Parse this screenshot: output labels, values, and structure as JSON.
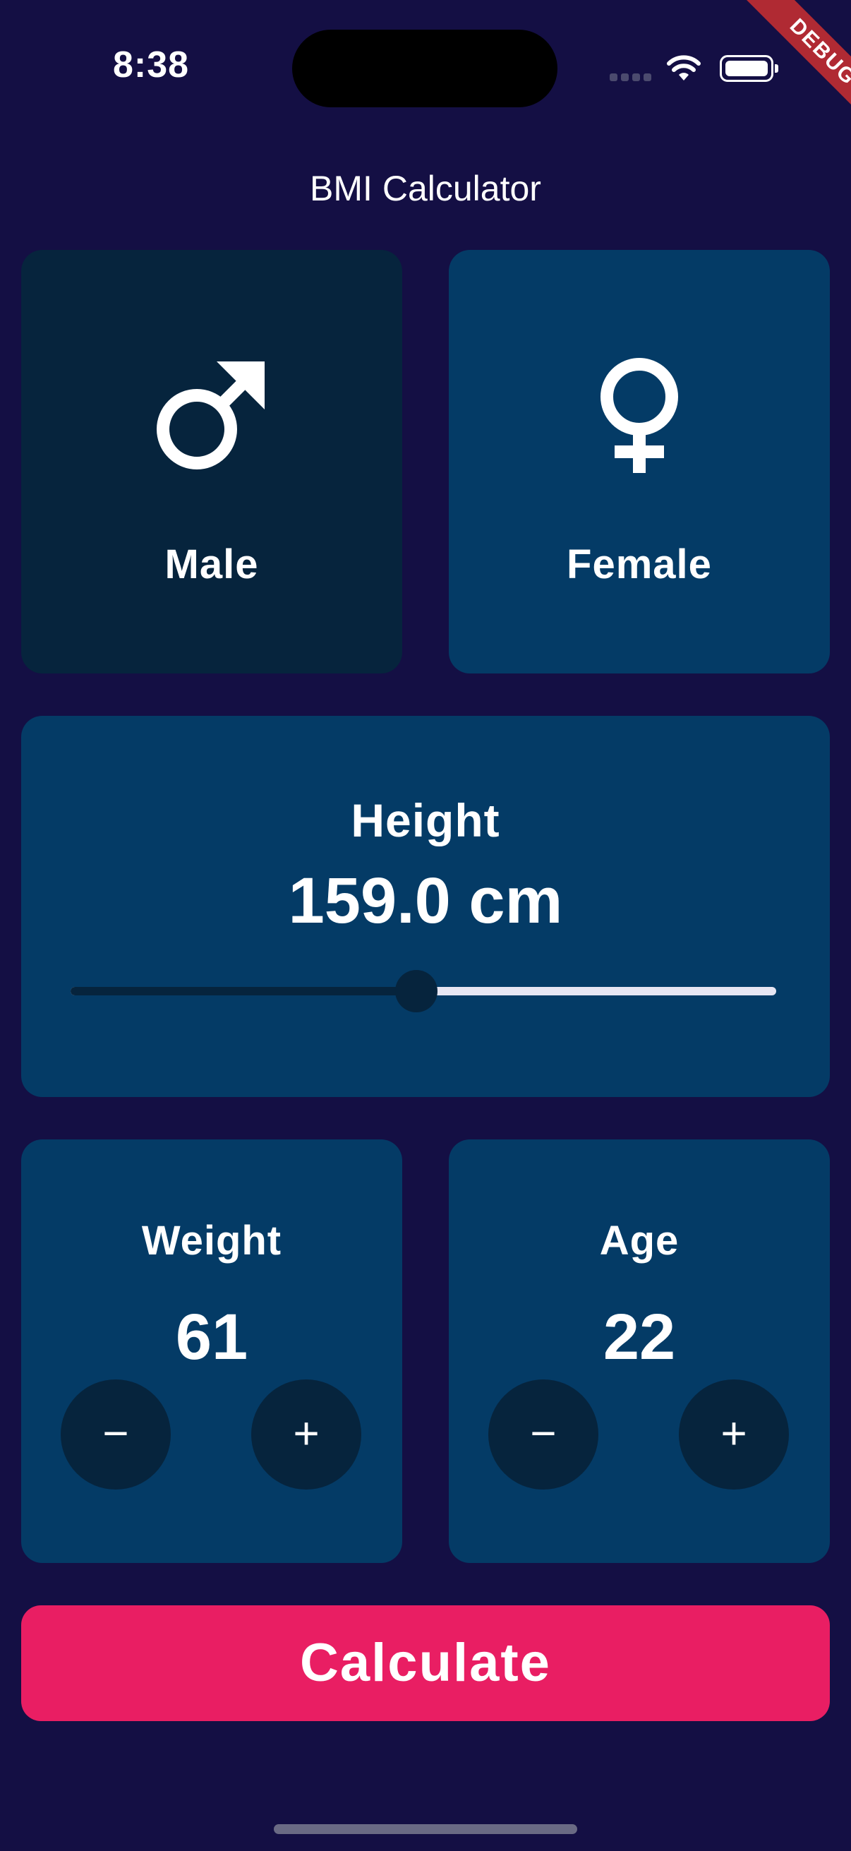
{
  "status_bar": {
    "time": "8:38"
  },
  "debug_banner": "DEBUG",
  "app": {
    "title": "BMI Calculator"
  },
  "gender": {
    "male": {
      "label": "Male",
      "icon": "male-icon",
      "selected": true
    },
    "female": {
      "label": "Female",
      "icon": "female-icon",
      "selected": false
    }
  },
  "height": {
    "label": "Height",
    "value_text": "159.0 cm",
    "slider_fraction": 0.49
  },
  "weight": {
    "label": "Weight",
    "value": "61",
    "minus": "−",
    "plus": "+"
  },
  "age": {
    "label": "Age",
    "value": "22",
    "minus": "−",
    "plus": "+"
  },
  "calculate_button": {
    "label": "Calculate"
  },
  "colors": {
    "background": "#140f44",
    "card": "#043b66",
    "card_inactive": "#06243d",
    "accent": "#e91e63",
    "debug_banner": "#b02a33"
  }
}
